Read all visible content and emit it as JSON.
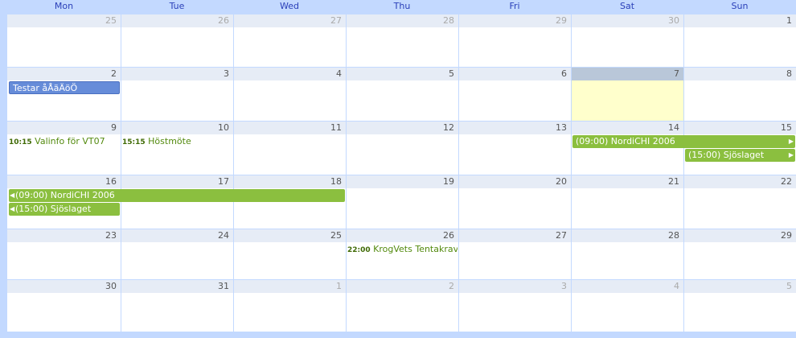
{
  "weekdays": [
    "Mon",
    "Tue",
    "Wed",
    "Thu",
    "Fri",
    "Sat",
    "Sun"
  ],
  "weeks": [
    {
      "days": [
        "25",
        "26",
        "27",
        "28",
        "29",
        "30",
        "1"
      ],
      "other": [
        1,
        1,
        1,
        1,
        1,
        1,
        0
      ]
    },
    {
      "days": [
        "2",
        "3",
        "4",
        "5",
        "6",
        "7",
        "8"
      ],
      "other": [
        0,
        0,
        0,
        0,
        0,
        0,
        0
      ]
    },
    {
      "days": [
        "9",
        "10",
        "11",
        "12",
        "13",
        "14",
        "15"
      ],
      "other": [
        0,
        0,
        0,
        0,
        0,
        0,
        0
      ]
    },
    {
      "days": [
        "16",
        "17",
        "18",
        "19",
        "20",
        "21",
        "22"
      ],
      "other": [
        0,
        0,
        0,
        0,
        0,
        0,
        0
      ]
    },
    {
      "days": [
        "23",
        "24",
        "25",
        "26",
        "27",
        "28",
        "29"
      ],
      "other": [
        0,
        0,
        0,
        0,
        0,
        0,
        0
      ]
    },
    {
      "days": [
        "30",
        "31",
        "1",
        "2",
        "3",
        "4",
        "5"
      ],
      "other": [
        0,
        0,
        1,
        1,
        1,
        1,
        1
      ]
    }
  ],
  "today": {
    "week": 1,
    "day": 5
  },
  "events": [
    {
      "week": 1,
      "day": 0,
      "span": 1,
      "slot": 0,
      "style": "blue",
      "title": "Testar åÅäÄöÖ"
    },
    {
      "week": 2,
      "day": 0,
      "span": 1,
      "slot": 0,
      "style": "timed",
      "time": "10:15",
      "title": "Valinfo för VT07"
    },
    {
      "week": 2,
      "day": 1,
      "span": 1,
      "slot": 0,
      "style": "timed",
      "time": "15:15",
      "title": "Höstmöte"
    },
    {
      "week": 2,
      "day": 5,
      "span": 2,
      "slot": 0,
      "style": "green",
      "title": "(09:00) NordiCHI 2006",
      "cont_right": true
    },
    {
      "week": 2,
      "day": 6,
      "span": 1,
      "slot": 1,
      "style": "green",
      "title": "(15:00) Sjöslaget",
      "cont_right": true
    },
    {
      "week": 3,
      "day": 0,
      "span": 3,
      "slot": 0,
      "style": "green",
      "title": "(09:00) NordiCHI 2006",
      "cont_left": true
    },
    {
      "week": 3,
      "day": 0,
      "span": 1,
      "slot": 1,
      "style": "green",
      "title": "(15:00) Sjöslaget",
      "cont_left": true
    },
    {
      "week": 4,
      "day": 3,
      "span": 1,
      "slot": 0,
      "style": "timed",
      "time": "22:00",
      "title": "KrogVets Tentakravall"
    }
  ],
  "colors": {
    "accent": "#c3d9ff",
    "event_blue": "#668cd9",
    "event_green": "#8bbf3f",
    "today": "#ffffcc"
  }
}
